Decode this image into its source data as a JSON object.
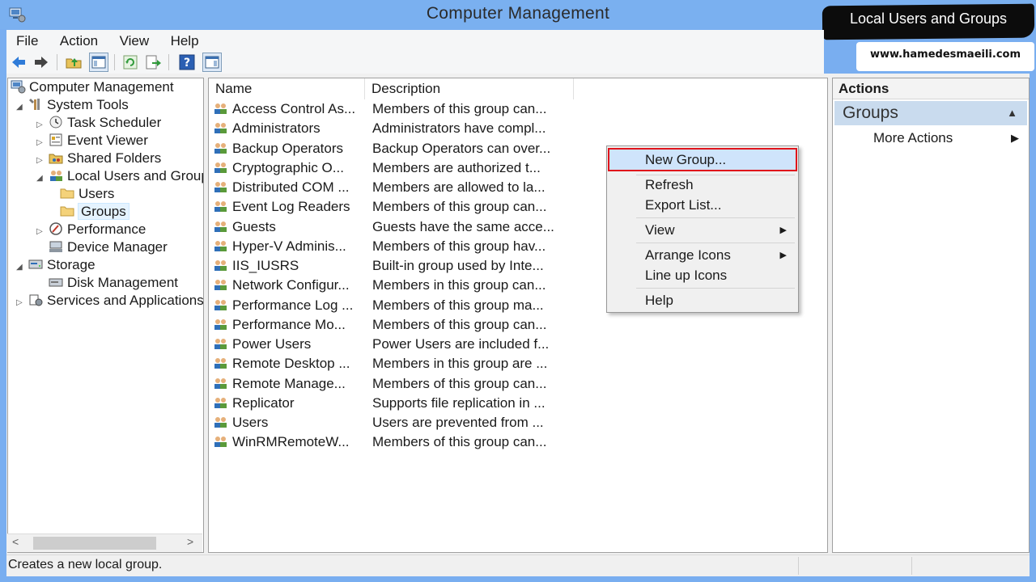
{
  "window": {
    "title": "Computer Management"
  },
  "watermark": {
    "caption": "Local Users and Groups",
    "url": "www.hamedesmaeili.com"
  },
  "menu": [
    "File",
    "Action",
    "View",
    "Help"
  ],
  "toolbar": [
    "back-icon",
    "forward-icon",
    "up-folder-icon",
    "show-hide-tree-icon",
    "refresh-icon",
    "export-list-icon",
    "help-icon",
    "show-hide-action-pane-icon"
  ],
  "tree": [
    {
      "label": "Computer Management",
      "icon": "computer-management-icon",
      "arrow": ""
    },
    {
      "label": "System Tools",
      "icon": "system-tools-icon",
      "arrow": "◢"
    },
    {
      "label": "Task Scheduler",
      "icon": "task-scheduler-icon",
      "arrow": "▷"
    },
    {
      "label": "Event Viewer",
      "icon": "event-viewer-icon",
      "arrow": "▷"
    },
    {
      "label": "Shared Folders",
      "icon": "shared-folders-icon",
      "arrow": "▷"
    },
    {
      "label": "Local Users and Groups",
      "icon": "users-icon",
      "arrow": "◢"
    },
    {
      "label": "Users",
      "icon": "folder-icon",
      "arrow": ""
    },
    {
      "label": "Groups",
      "icon": "folder-icon",
      "arrow": ""
    },
    {
      "label": "Performance",
      "icon": "performance-icon",
      "arrow": "▷"
    },
    {
      "label": "Device Manager",
      "icon": "device-manager-icon",
      "arrow": ""
    },
    {
      "label": "Storage",
      "icon": "storage-icon",
      "arrow": "◢"
    },
    {
      "label": "Disk Management",
      "icon": "disk-management-icon",
      "arrow": ""
    },
    {
      "label": "Services and Applications",
      "icon": "services-icon",
      "arrow": "▷"
    }
  ],
  "list": {
    "columns": [
      "Name",
      "Description"
    ],
    "rows": [
      {
        "name": "Access Control As...",
        "desc": "Members of this group can..."
      },
      {
        "name": "Administrators",
        "desc": "Administrators have compl..."
      },
      {
        "name": "Backup Operators",
        "desc": "Backup Operators can over..."
      },
      {
        "name": "Cryptographic O...",
        "desc": "Members are authorized t..."
      },
      {
        "name": "Distributed COM ...",
        "desc": "Members are allowed to la..."
      },
      {
        "name": "Event Log Readers",
        "desc": "Members of this group can..."
      },
      {
        "name": "Guests",
        "desc": "Guests have the same acce..."
      },
      {
        "name": "Hyper-V Adminis...",
        "desc": "Members of this group hav..."
      },
      {
        "name": "IIS_IUSRS",
        "desc": "Built-in group used by Inte..."
      },
      {
        "name": "Network Configur...",
        "desc": "Members in this group can..."
      },
      {
        "name": "Performance Log ...",
        "desc": "Members of this group ma..."
      },
      {
        "name": "Performance Mo...",
        "desc": "Members of this group can..."
      },
      {
        "name": "Power Users",
        "desc": "Power Users are included f..."
      },
      {
        "name": "Remote Desktop ...",
        "desc": "Members in this group are ..."
      },
      {
        "name": "Remote Manage...",
        "desc": "Members of this group can..."
      },
      {
        "name": "Replicator",
        "desc": "Supports file replication in ..."
      },
      {
        "name": "Users",
        "desc": "Users are prevented from ..."
      },
      {
        "name": "WinRMRemoteW...",
        "desc": "Members of this group can..."
      }
    ]
  },
  "context_menu": {
    "items": [
      {
        "label": "New Group...",
        "submenu": false
      },
      {
        "label": "Refresh",
        "submenu": false
      },
      {
        "label": "Export List...",
        "submenu": false
      },
      {
        "label": "View",
        "submenu": true
      },
      {
        "label": "Arrange Icons",
        "submenu": true
      },
      {
        "label": "Line up Icons",
        "submenu": false
      },
      {
        "label": "Help",
        "submenu": false
      }
    ],
    "highlighted": "New Group..."
  },
  "actions": {
    "title": "Actions",
    "group": "Groups",
    "more": "More Actions"
  },
  "status": {
    "text": "Creates a new local group."
  },
  "colors": {
    "title_bar": "#7ab0f0",
    "highlight_border": "#e0141b",
    "selection": "#cfe4fb",
    "actions_group": "#c9dbee"
  }
}
